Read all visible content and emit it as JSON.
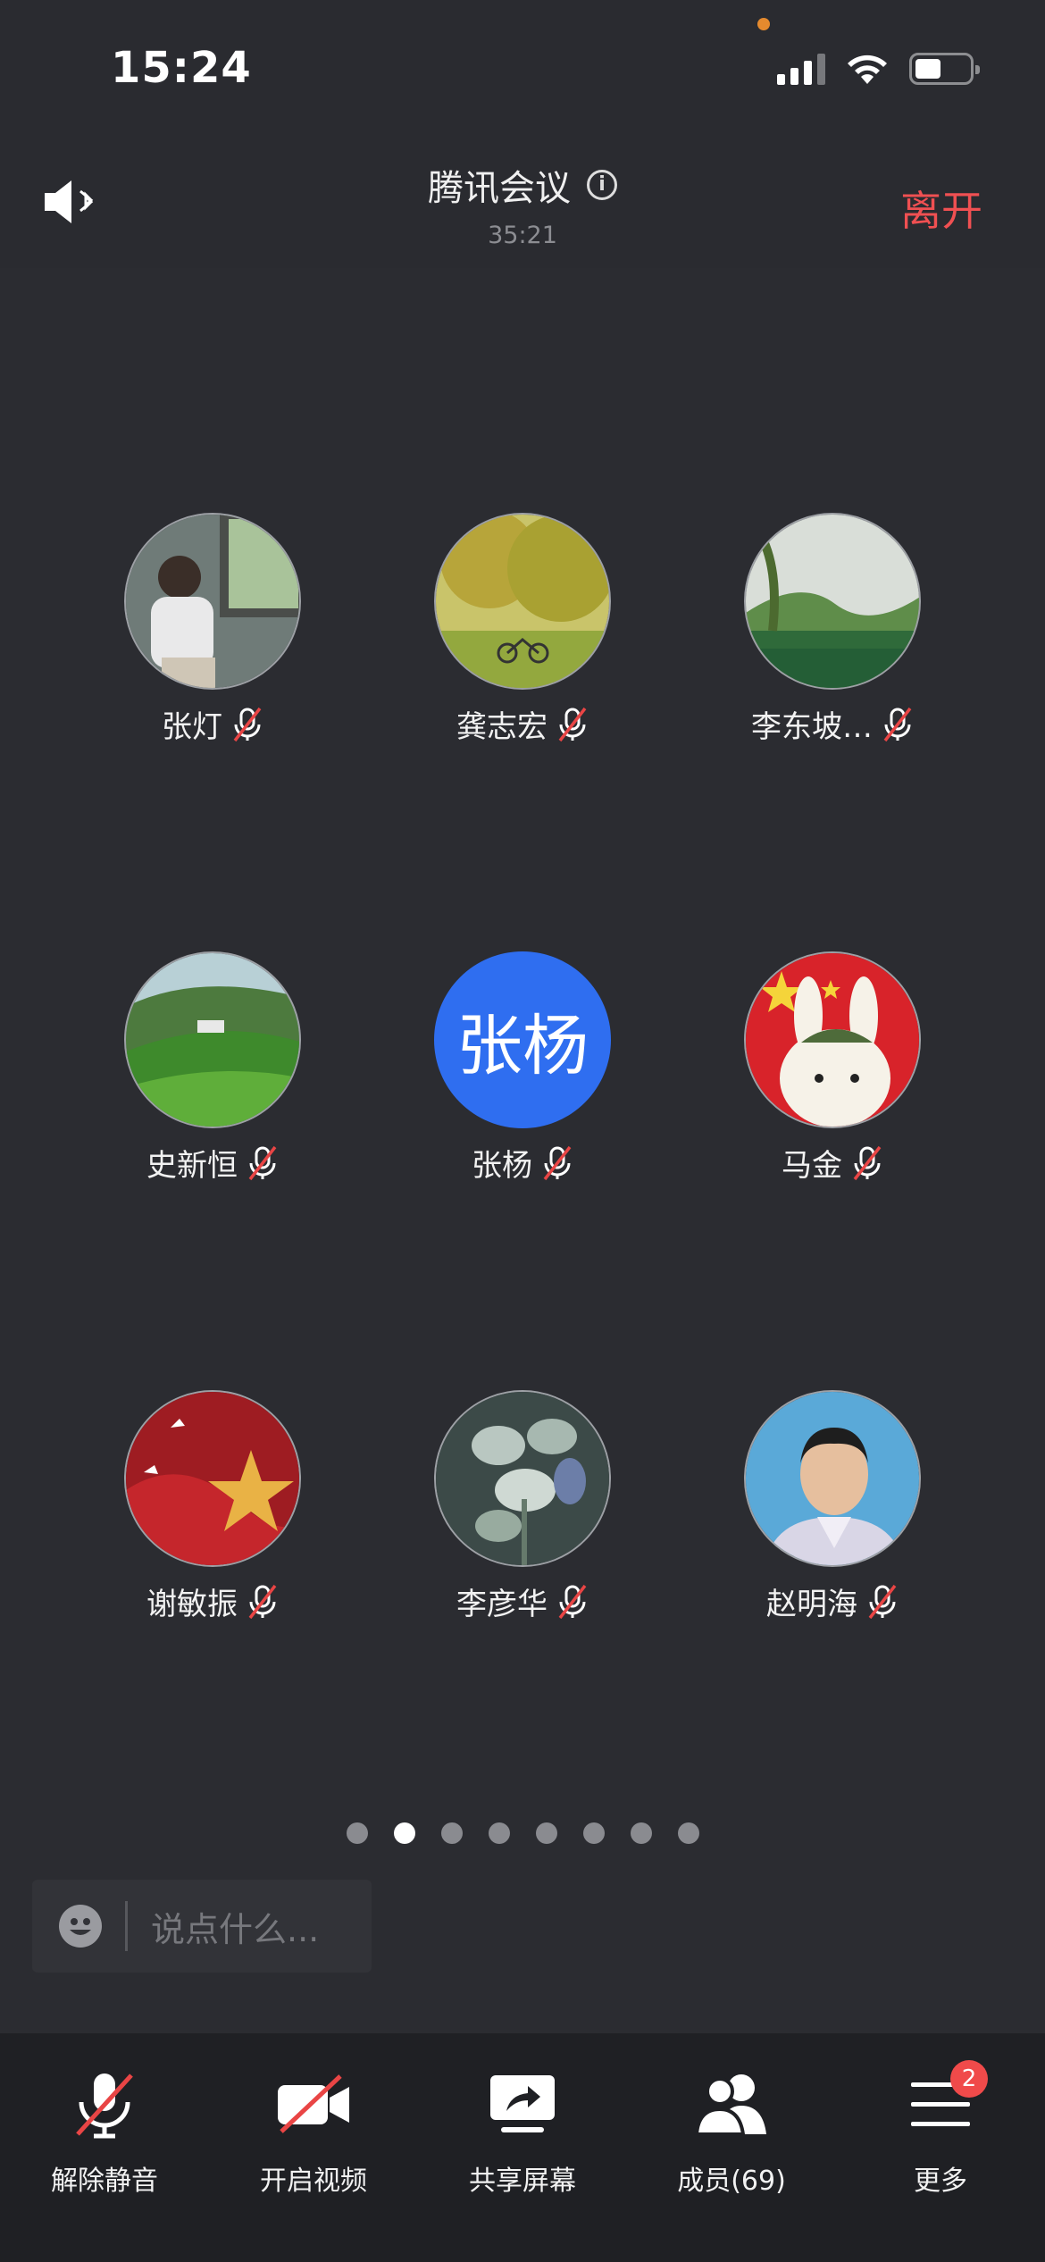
{
  "status_bar": {
    "time": "15:24"
  },
  "header": {
    "title": "腾讯会议",
    "timer": "35:21",
    "leave_label": "离开"
  },
  "participants": [
    {
      "name": "张灯",
      "muted": true
    },
    {
      "name": "龚志宏",
      "muted": true
    },
    {
      "name": "李东坡…",
      "muted": true
    },
    {
      "name": "史新恒",
      "muted": true
    },
    {
      "name": "张杨",
      "avatar_text": "张杨",
      "avatar_color": "#2f6ef0",
      "muted": true
    },
    {
      "name": "马金",
      "muted": true
    },
    {
      "name": "谢敏振",
      "muted": true
    },
    {
      "name": "李彦华",
      "muted": true
    },
    {
      "name": "赵明海",
      "muted": true
    }
  ],
  "pagination": {
    "pages": 8,
    "current": 2
  },
  "chat": {
    "placeholder": "说点什么..."
  },
  "toolbar": {
    "unmute": "解除静音",
    "start_video": "开启视频",
    "share_screen": "共享屏幕",
    "members": "成员(69)",
    "more": "更多",
    "more_badge": "2"
  },
  "colors": {
    "accent": "#2f6ef0",
    "danger": "#f05052",
    "background": "#2b2c31"
  }
}
